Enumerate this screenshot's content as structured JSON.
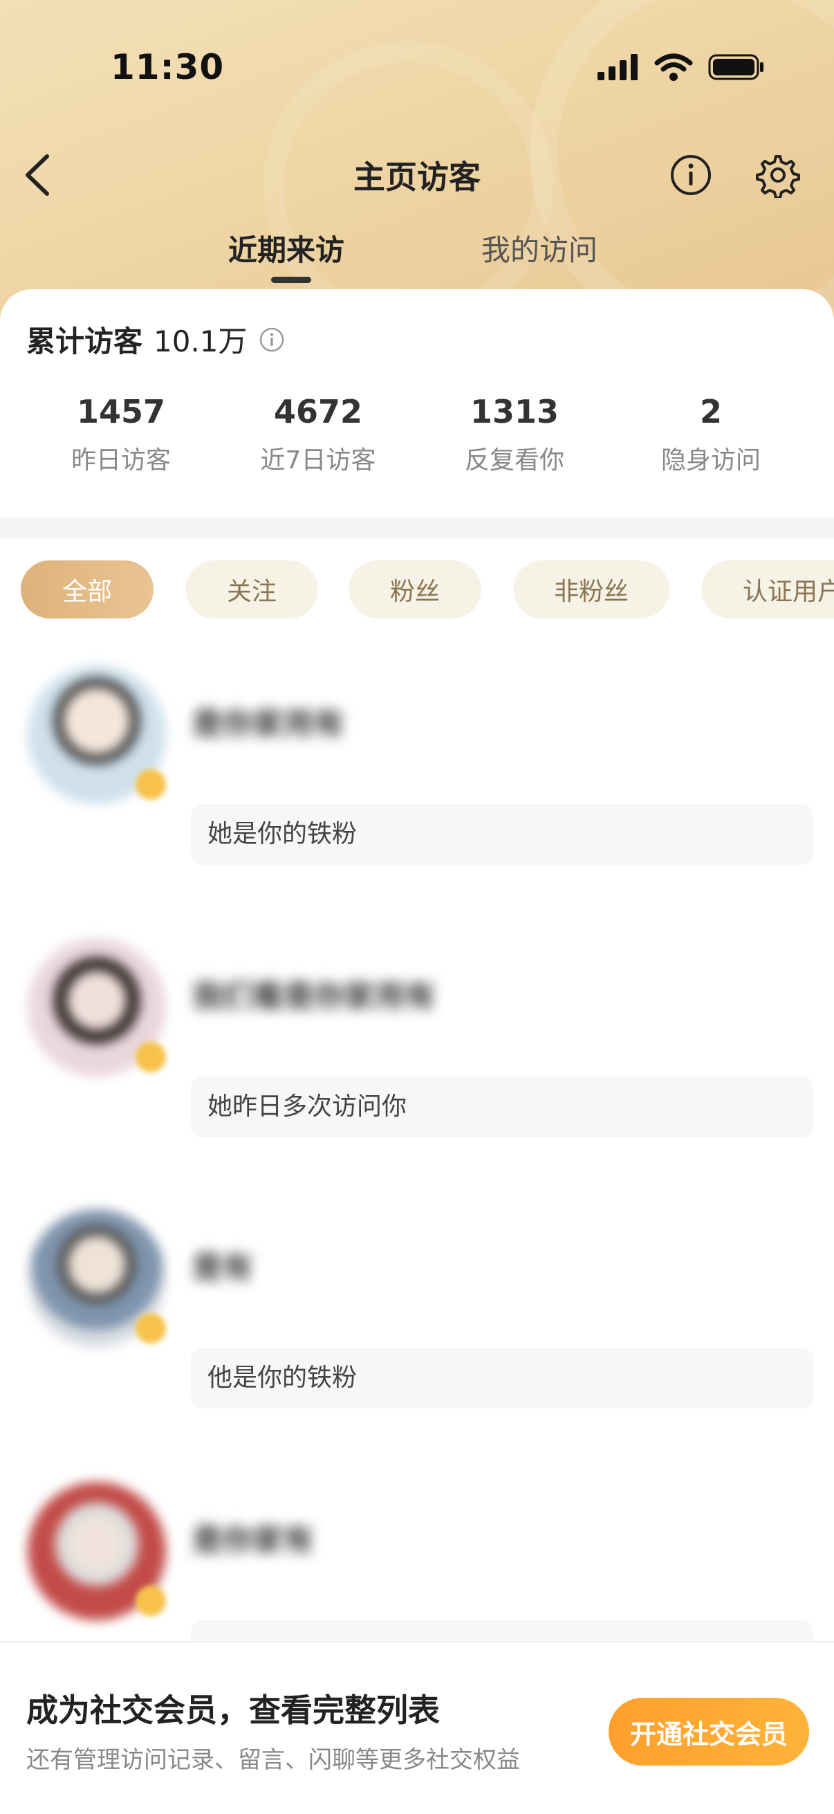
{
  "status_bar": {
    "time": "11:30"
  },
  "nav": {
    "title": "主页访客"
  },
  "tabs": [
    {
      "label": "近期来访",
      "active": true
    },
    {
      "label": "我的访问",
      "active": false
    }
  ],
  "summary": {
    "label": "累计访客",
    "value": "10.1万"
  },
  "stats": [
    {
      "value": "1457",
      "label": "昨日访客"
    },
    {
      "value": "4672",
      "label": "近7日访客"
    },
    {
      "value": "1313",
      "label": "反复看你"
    },
    {
      "value": "2",
      "label": "隐身访问"
    }
  ],
  "filters": [
    "全部",
    "关注",
    "粉丝",
    "非粉丝",
    "认证用户"
  ],
  "visitors": [
    {
      "name": "是你家用有",
      "note": "她是你的铁粉"
    },
    {
      "name": "我们看是你家用有",
      "note": "她昨日多次访问你"
    },
    {
      "name": "是有",
      "note": "他是你的铁粉"
    },
    {
      "name": "是你家有",
      "note": ""
    }
  ],
  "promo": {
    "title": "成为社交会员，查看完整列表",
    "subtitle": "还有管理访问记录、留言、闪聊等更多社交权益",
    "button": "开通社交会员"
  },
  "colors": {
    "header_gold": "#efd6a6",
    "chip_active": "#dfb27a",
    "cta_orange": "#ff9f2c"
  }
}
